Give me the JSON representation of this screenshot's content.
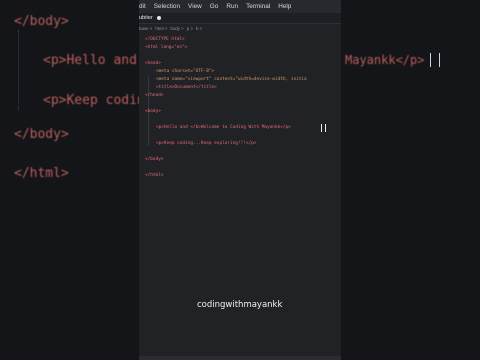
{
  "menu": [
    "dit",
    "Selection",
    "View",
    "Go",
    "Run",
    "Terminal",
    "Help"
  ],
  "tab": {
    "label": "ubiter"
  },
  "breadcrumb": [
    "base >",
    "html >",
    "body >",
    "p >",
    "b >"
  ],
  "code_lines": [
    "<!DOCTYPE html>",
    "<html lang=\"en\">",
    "<head>",
    "<meta charset=\"UTF-8\">",
    "<meta name=\"viewport\" content=\"width=device-width, initia",
    "<title>Document</title>",
    "</head>",
    "<body>",
    "<p>Hello and </b>Welcome to Coding With Mayankk</p>",
    "<p>Keep coding...Keep exploring!!!</p>",
    "</body>",
    "</html>"
  ],
  "background": {
    "body_open": "</body>",
    "p_hello": "<p>Hello and",
    "p_keep": "<p>Keep codin",
    "body_close": "</body>",
    "html_close": "</html>",
    "right_text": "Mayankk</p>"
  },
  "watermark": "codingwithmayankk",
  "colors": {
    "tag": "#e06c75",
    "attr": "#d19a66",
    "string": "#98c379",
    "panel_bg": "#202226"
  }
}
